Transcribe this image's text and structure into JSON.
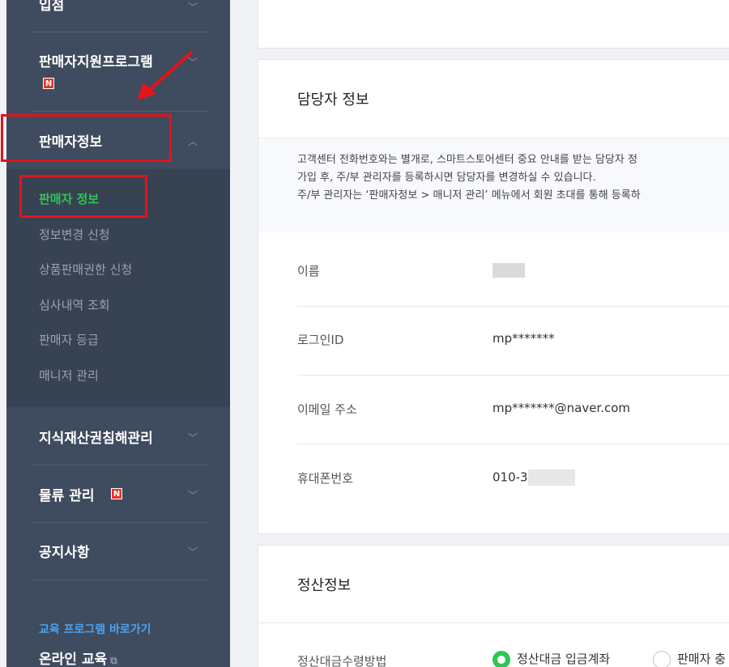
{
  "sidebar": {
    "top_partial": "입점",
    "menus": [
      {
        "label": "판매자지원프로그램",
        "badge": "N"
      },
      {
        "label": "판매자정보"
      },
      {
        "label": "지식재산권침해관리"
      },
      {
        "label": "물류 관리",
        "badge": "N"
      },
      {
        "label": "공지사항"
      }
    ],
    "sub_items": [
      "판매자 정보",
      "정보변경 신청",
      "상품판매권한 신청",
      "심사내역 조회",
      "판매자 등급",
      "매니저 관리"
    ],
    "edu_link": "교육 프로그램 바로가기",
    "online_edu": "온라인 교육"
  },
  "icons": {
    "chevron": "chevron-down-icon",
    "expanded": "chevron-up-icon",
    "external": "external-link-icon"
  },
  "colors": {
    "sidebar_bg": "#3f4b5e",
    "active_green": "#2dc653",
    "highlight_red": "#e3141a",
    "badge_red": "#e8332a"
  },
  "contact": {
    "title": "담당자 정보",
    "notice": [
      "고객센터 전화번호와는 별개로, 스마트스토어센터 중요 안내를 받는 담당자 정",
      "가입 후, 주/부 관리자를 등록하시면 담당자를 변경하실 수 있습니다.",
      "주/부 관리자는 ‘판매자정보 > 매니저 관리’ 메뉴에서 회원 초대를 통해 등록하"
    ],
    "rows": [
      {
        "label": "이름",
        "value": ""
      },
      {
        "label": "로그인ID",
        "value": "mp*******"
      },
      {
        "label": "이메일 주소",
        "value": "mp*******@naver.com"
      },
      {
        "label": "휴대폰번호",
        "value": "010-3"
      }
    ]
  },
  "settlement": {
    "title": "정산정보",
    "row_label": "정산대금수령방법",
    "options": [
      "정산대금 입금계좌",
      "판매자 충"
    ]
  }
}
